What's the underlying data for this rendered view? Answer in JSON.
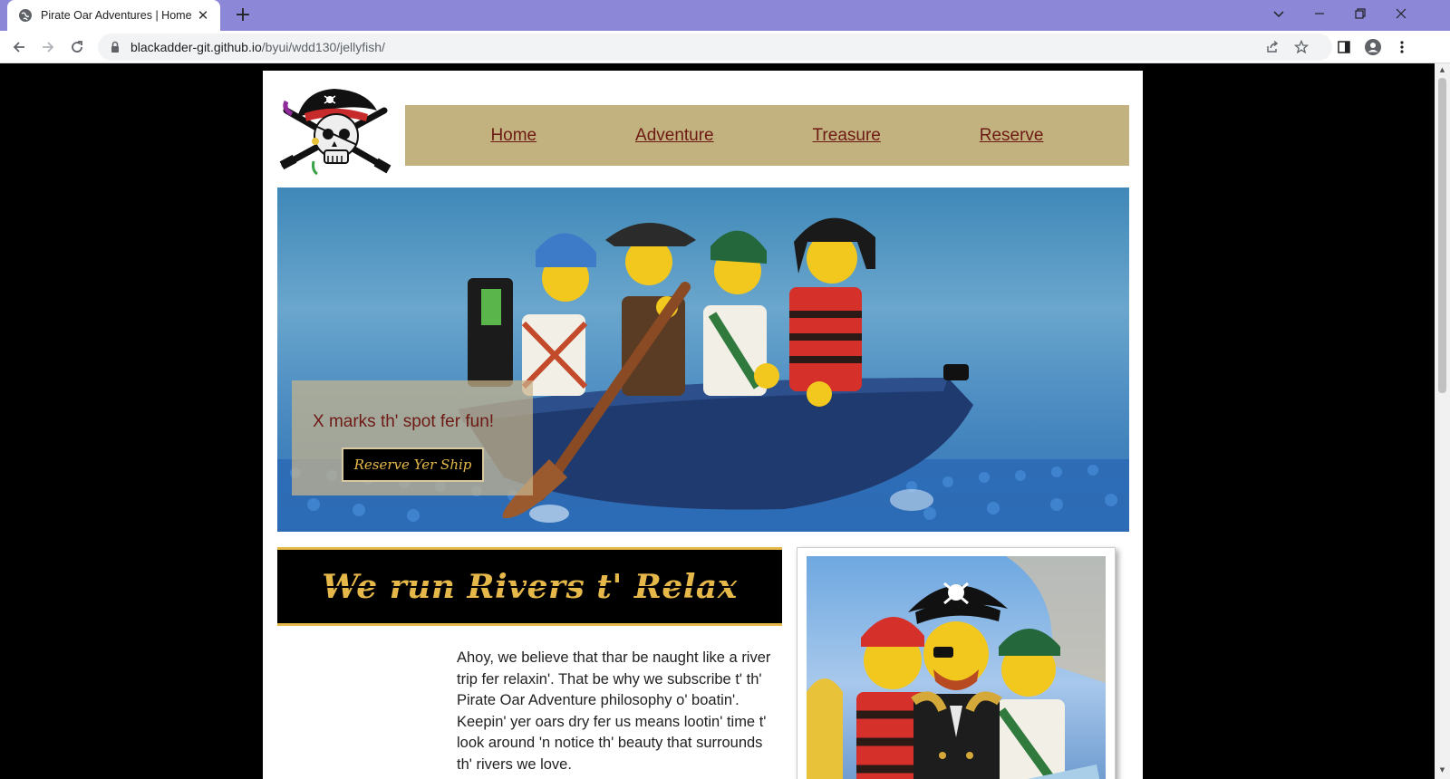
{
  "browser": {
    "tab_title": "Pirate Oar Adventures | Home",
    "url_host": "blackadder-git.github.io",
    "url_path": "/byui/wdd130/jellyfish/"
  },
  "nav": {
    "items": [
      "Home",
      "Adventure",
      "Treasure",
      "Reserve"
    ]
  },
  "hero": {
    "tagline": "X marks th' spot fer fun!",
    "button_label": "Reserve Yer Ship"
  },
  "welcome": {
    "heading": "We run Rivers t' Relax"
  },
  "body": {
    "paragraph": "Ahoy, we believe that thar be naught like a river trip fer relaxin'. That be why we subscribe t' th' Pirate Oar Adventure philosophy o' boatin'. Keepin' yer oars dry fer us means lootin' time t' look around 'n notice th' beauty that surrounds th' rivers we love."
  },
  "icons": {
    "favicon": "globe-icon",
    "lock": "lock-icon",
    "logo": "pirate-skull-logo"
  },
  "colors": {
    "tabbar": "#8c87d6",
    "nav_bg": "#c2b280",
    "nav_link": "#6e1a14",
    "gold": "#e6b84a"
  }
}
